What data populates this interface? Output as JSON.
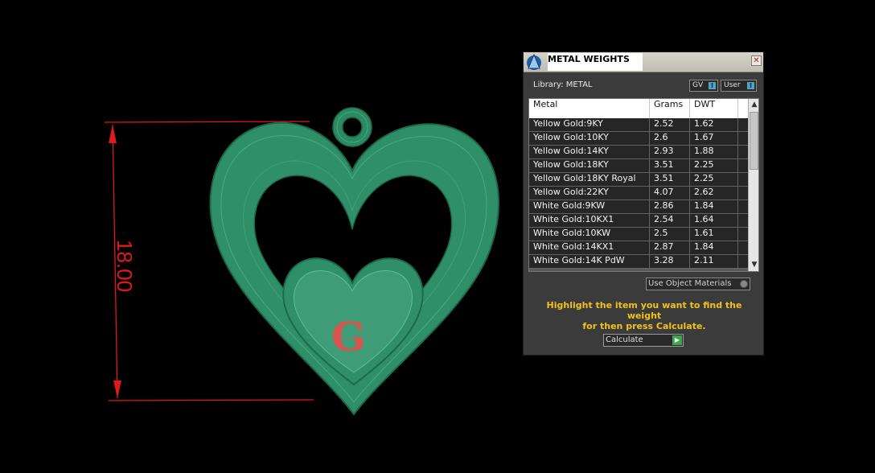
{
  "viewport": {
    "dimension_label": "18.00",
    "pendant_initial": "G",
    "colors": {
      "model": "#2f8f68",
      "dimension": "#e0191b",
      "initial": "#d9534f",
      "background": "#000000"
    }
  },
  "panel": {
    "title": "METAL WEIGHTS",
    "close_glyph": "✕",
    "library_label": "Library: METAL",
    "gv_label": "GV",
    "user_label": "User",
    "toggle_glyph": "I",
    "columns": [
      "Metal",
      "Grams",
      "DWT"
    ],
    "rows": [
      {
        "metal": "Yellow Gold:9KY",
        "grams": "2.52",
        "dwt": "1.62"
      },
      {
        "metal": "Yellow Gold:10KY",
        "grams": "2.6",
        "dwt": "1.67"
      },
      {
        "metal": "Yellow Gold:14KY",
        "grams": "2.93",
        "dwt": "1.88"
      },
      {
        "metal": "Yellow Gold:18KY",
        "grams": "3.51",
        "dwt": "2.25"
      },
      {
        "metal": "Yellow Gold:18KY Royal",
        "grams": "3.51",
        "dwt": "2.25"
      },
      {
        "metal": "Yellow Gold:22KY",
        "grams": "4.07",
        "dwt": "2.62"
      },
      {
        "metal": "White Gold:9KW",
        "grams": "2.86",
        "dwt": "1.84"
      },
      {
        "metal": "White Gold:10KX1",
        "grams": "2.54",
        "dwt": "1.64"
      },
      {
        "metal": "White Gold:10KW",
        "grams": "2.5",
        "dwt": "1.61"
      },
      {
        "metal": "White Gold:14KX1",
        "grams": "2.87",
        "dwt": "1.84"
      },
      {
        "metal": "White Gold:14K PdW",
        "grams": "3.28",
        "dwt": "2.11"
      }
    ],
    "use_object_materials": "Use Object Materials",
    "hint_line1": "Highlight the item you want to find the weight",
    "hint_line2": "for then press Calculate.",
    "calculate_label": "Calculate",
    "scroll_up": "▲",
    "scroll_down": "▼",
    "play_glyph": "▶"
  }
}
